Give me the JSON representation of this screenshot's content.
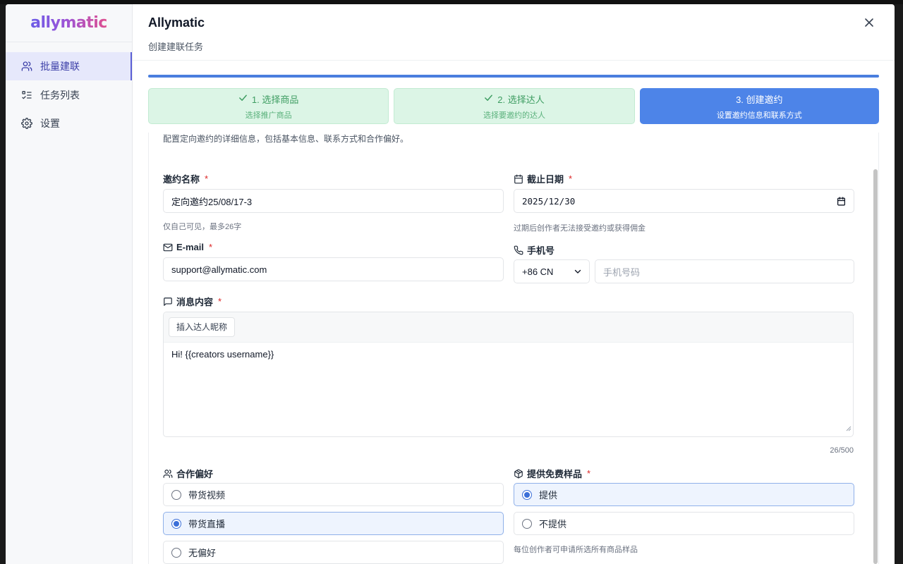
{
  "sidebar": {
    "logo": "allymatic",
    "items": [
      {
        "label": "批量建联",
        "icon": "users-icon",
        "active": true
      },
      {
        "label": "任务列表",
        "icon": "list-icon",
        "active": false
      },
      {
        "label": "设置",
        "icon": "gear-icon",
        "active": false
      }
    ]
  },
  "header": {
    "title": "Allymatic",
    "subtitle": "创建建联任务"
  },
  "progress": {
    "percent": 100
  },
  "steps": [
    {
      "title": "1. 选择商品",
      "subtitle": "选择推广商品",
      "status": "done"
    },
    {
      "title": "2. 选择达人",
      "subtitle": "选择要邀约的达人",
      "status": "done"
    },
    {
      "title": "3. 创建邀约",
      "subtitle": "设置邀约信息和联系方式",
      "status": "current"
    }
  ],
  "form": {
    "intro": "配置定向邀约的详细信息，包括基本信息、联系方式和合作偏好。",
    "required_mark": "*",
    "invite_name": {
      "label": "邀约名称",
      "value": "定向邀约25/08/17-3",
      "hint": "仅自己可见，最多26字"
    },
    "deadline": {
      "label": "截止日期",
      "value": "2025/12/30",
      "hint": "过期后创作者无法接受邀约或获得佣金"
    },
    "email": {
      "label": "E-mail",
      "value": "support@allymatic.com"
    },
    "phone": {
      "label": "手机号",
      "country_code": "+86 CN",
      "placeholder": "手机号码"
    },
    "message": {
      "label": "消息内容",
      "insert_button": "插入达人昵称",
      "value": "Hi! {{creators username}}",
      "counter": "26/500"
    },
    "cooperation": {
      "label": "合作偏好",
      "options": [
        {
          "label": "带货视频",
          "selected": false
        },
        {
          "label": "带货直播",
          "selected": true
        },
        {
          "label": "无偏好",
          "selected": false
        }
      ]
    },
    "samples": {
      "label": "提供免费样品",
      "options": [
        {
          "label": "提供",
          "selected": true
        },
        {
          "label": "不提供",
          "selected": false
        }
      ],
      "hint": "每位创作者可申请所选所有商品样品"
    }
  },
  "colors": {
    "primary": "#4d84e8",
    "done_bg": "#dcf5e6",
    "done_text": "#3e9d62",
    "active_nav": "#e6e8fb",
    "required": "#dc2626"
  }
}
